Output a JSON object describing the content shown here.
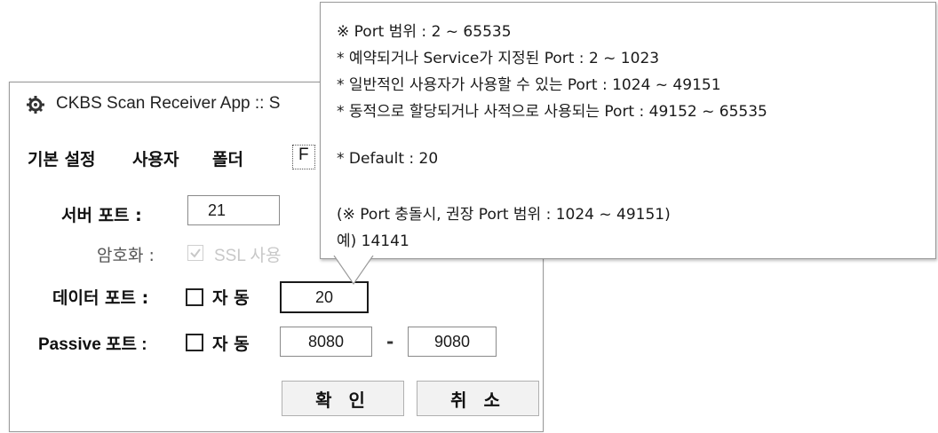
{
  "window": {
    "title": "CKBS Scan Receiver App :: S",
    "icon": "gear-app-icon"
  },
  "tabs": [
    {
      "label": "기본 설정"
    },
    {
      "label": "사용자"
    },
    {
      "label": "폴더"
    },
    {
      "label": "F"
    }
  ],
  "form": {
    "server_port_label": "서버 포트 :",
    "server_port_value": "21",
    "encryption_label": "암호화 :",
    "ssl_label": "SSL 사용",
    "ssl_checked": true,
    "data_port_label": "데이터 포트 :",
    "data_port_auto_label": "자 동",
    "data_port_auto_checked": false,
    "data_port_value": "20",
    "passive_port_label": "Passive 포트 :",
    "passive_port_auto_label": "자 동",
    "passive_port_auto_checked": false,
    "passive_port_from": "8080",
    "passive_separator": "-",
    "passive_port_to": "9080"
  },
  "buttons": {
    "ok_label": "확 인",
    "cancel_label": "취 소"
  },
  "tooltip": {
    "lines": [
      "※ Port 범위 : 2 ~ 65535",
      "* 예약되거나 Service가 지정된 Port : 2 ~ 1023",
      "* 일반적인 사용자가 사용할 수 있는 Port : 1024 ~ 49151",
      "* 동적으로 할당되거나 사적으로 사용되는 Port : 49152 ~ 65535",
      "* Default : 20",
      "(※ Port 충돌시, 권장 Port 범위 : 1024 ~ 49151)",
      "예) 14141"
    ]
  }
}
